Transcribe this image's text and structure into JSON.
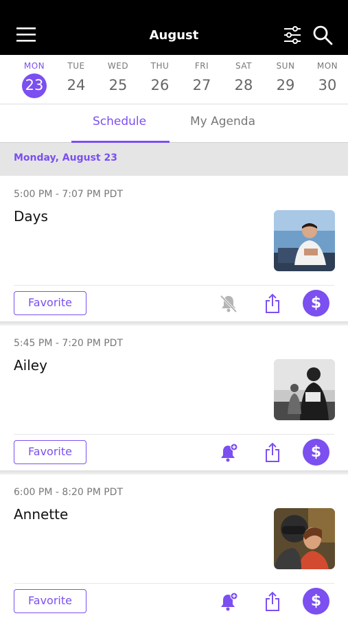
{
  "header": {
    "title": "August",
    "menu_icon": "hamburger-menu-icon",
    "filter_icon": "sliders-filter-icon",
    "search_icon": "search-icon"
  },
  "days": [
    {
      "dow": "MON",
      "num": "23",
      "active": true
    },
    {
      "dow": "TUE",
      "num": "24"
    },
    {
      "dow": "WED",
      "num": "25"
    },
    {
      "dow": "THU",
      "num": "26"
    },
    {
      "dow": "FRI",
      "num": "27"
    },
    {
      "dow": "SAT",
      "num": "28"
    },
    {
      "dow": "SUN",
      "num": "29"
    },
    {
      "dow": "MON",
      "num": "30"
    }
  ],
  "tabs": [
    {
      "label": "Schedule",
      "active": true
    },
    {
      "label": "My Agenda"
    }
  ],
  "date_heading": "Monday, August 23",
  "events": [
    {
      "time": "5:00 PM - 7:07 PM PDT",
      "name": "Days",
      "favorite_label": "Favorite",
      "bell_icon": "bell-off-icon",
      "share_icon": "share-icon",
      "buy_icon": "dollar-icon",
      "buy_label": "$"
    },
    {
      "time": "5:45 PM - 7:20 PM PDT",
      "name": "Ailey",
      "favorite_label": "Favorite",
      "bell_icon": "bell-add-icon",
      "share_icon": "share-icon",
      "buy_icon": "dollar-icon",
      "buy_label": "$"
    },
    {
      "time": "6:00 PM - 8:20 PM PDT",
      "name": "Annette",
      "favorite_label": "Favorite",
      "bell_icon": "bell-add-icon",
      "share_icon": "share-icon",
      "buy_icon": "dollar-icon",
      "buy_label": "$"
    }
  ],
  "colors": {
    "accent": "#7b4ff0",
    "header_bg": "#000000",
    "date_bar_bg": "#e5e5e5"
  }
}
